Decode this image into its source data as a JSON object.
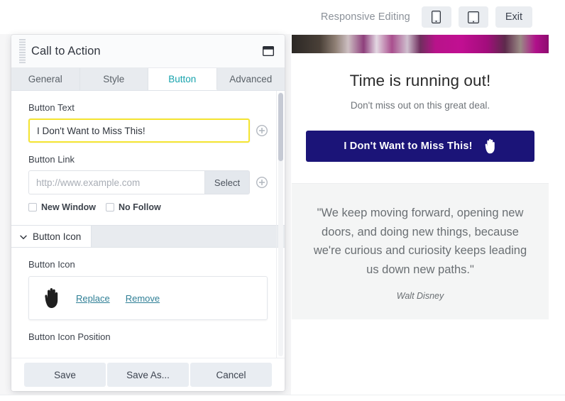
{
  "topbar": {
    "responsive_label": "Responsive Editing",
    "devices": [
      {
        "name": "mobile-icon",
        "tooltip": "Mobile"
      },
      {
        "name": "tablet-icon",
        "tooltip": "Tablet"
      }
    ],
    "exit_label": "Exit"
  },
  "panel": {
    "title": "Call to Action",
    "grip_icon": "drag-grip-icon",
    "window_icon": "restore-window-icon",
    "tabs": [
      {
        "label": "General",
        "active": false
      },
      {
        "label": "Style",
        "active": false
      },
      {
        "label": "Button",
        "active": true
      },
      {
        "label": "Advanced",
        "active": false
      }
    ],
    "fields": {
      "button_text_label": "Button Text",
      "button_text_value": "I Don't Want to Miss This!",
      "button_link_label": "Button Link",
      "button_link_value": "",
      "button_link_placeholder": "http://www.example.com",
      "link_select_label": "Select",
      "checkboxes": [
        {
          "label": "New Window",
          "checked": false
        },
        {
          "label": "No Follow",
          "checked": false
        }
      ],
      "section_button_icon": "Button Icon",
      "button_icon_label": "Button Icon",
      "icon_preview_name": "hand-icon",
      "replace_label": "Replace",
      "remove_label": "Remove",
      "button_icon_position_label": "Button Icon Position"
    },
    "footer": {
      "save_label": "Save",
      "save_as_label": "Save As...",
      "cancel_label": "Cancel"
    },
    "add_icon_name": "plus-circle-icon"
  },
  "preview": {
    "heading": "Time is running out!",
    "subheading": "Don't miss out on this great deal.",
    "cta_label": "I Don't Want to Miss This!",
    "cta_icon_name": "hand-icon",
    "cta_color": "#1b1478",
    "quote": "\"We keep moving forward, opening new doors, and doing new things, because we're curious and curiosity keeps leading us down new paths.\"",
    "quote_author": "Walt Disney"
  },
  "colors": {
    "accent_tab": "#17a3ad",
    "highlight_border": "#f5e531",
    "link": "#2f7f96",
    "cta": "#1b1478",
    "panel_chrome": "#e8ebef"
  }
}
